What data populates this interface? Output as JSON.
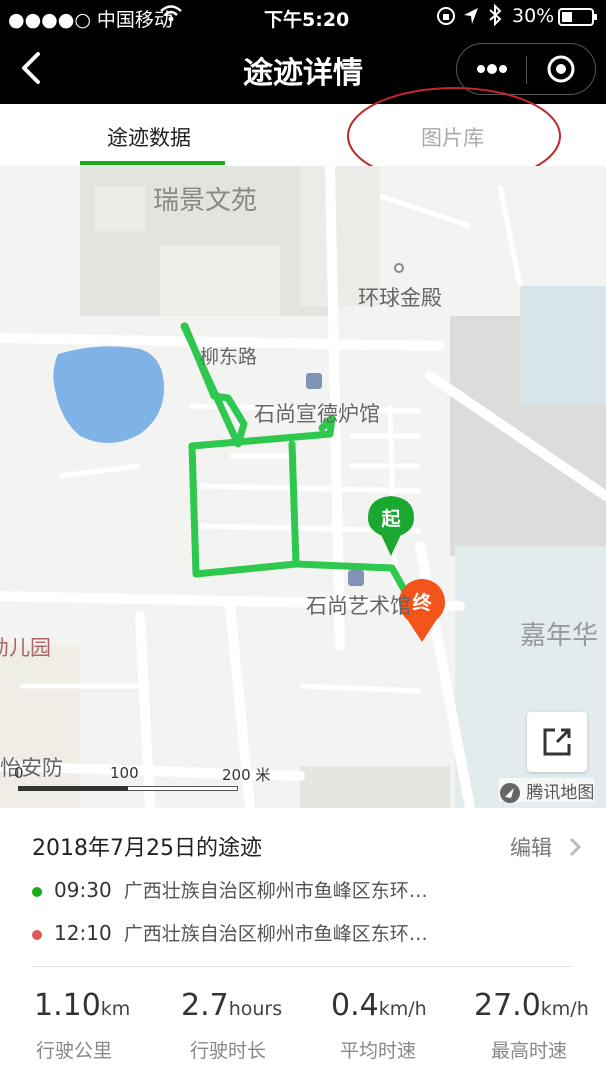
{
  "status": {
    "carrier": "●●●●○ 中国移动",
    "time": "下午5:20",
    "battery": "30%"
  },
  "nav": {
    "title": "途迹详情"
  },
  "tabs": [
    {
      "label": "途迹数据",
      "active": true
    },
    {
      "label": "图片库",
      "active": false
    }
  ],
  "map": {
    "labels": {
      "ruijing": "瑞景文苑",
      "huanqiu": "环球金殿",
      "liudong": "柳东路",
      "xuande": "石尚宣德炉馆",
      "yishu": "石尚艺术馆",
      "jianianhua": "嘉年华",
      "youeryuan": "幼儿园",
      "yian": "怡安防"
    },
    "markers": {
      "start": "起",
      "end": "终"
    },
    "scale": {
      "zero": "0",
      "mid": "100",
      "max": "200 米"
    },
    "brand": "腾讯地图"
  },
  "trip": {
    "title": "2018年7月25日的途迹",
    "edit": "编辑",
    "start_time": "09:30",
    "start_addr": "广西壮族自治区柳州市鱼峰区东环…",
    "end_time": "12:10",
    "end_addr": "广西壮族自治区柳州市鱼峰区东环…"
  },
  "stats": [
    {
      "value": "1.10",
      "unit": "km",
      "label": "行驶公里"
    },
    {
      "value": "2.7",
      "unit": "hours",
      "label": "行驶时长"
    },
    {
      "value": "0.4",
      "unit": "km/h",
      "label": "平均时速"
    },
    {
      "value": "27.0",
      "unit": "km/h",
      "label": "最高时速"
    }
  ],
  "colors": {
    "route": "#2ec84e",
    "start_pin": "#1aa831",
    "end_pin": "#f2541b",
    "active_tab": "#1aad19",
    "annotation": "#c0282a"
  }
}
